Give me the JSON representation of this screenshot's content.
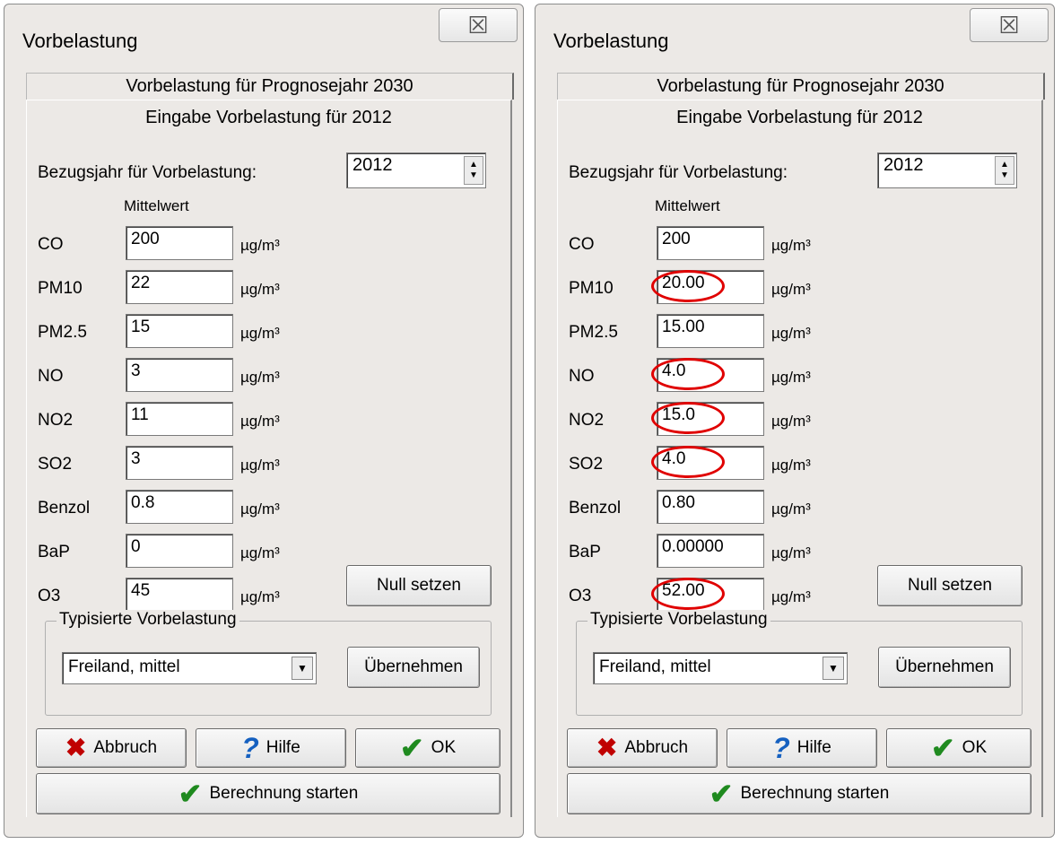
{
  "dialogs": [
    {
      "title": "Vorbelastung",
      "close_glyph": "☒",
      "tab_label": "Vorbelastung für Prognosejahr 2030",
      "panel_title": "Eingabe Vorbelastung für 2012",
      "year_label": "Bezugsjahr für Vorbelastung:",
      "year_value": "2012",
      "mean_header": "Mittelwert",
      "rows": [
        {
          "name": "CO",
          "value": "200",
          "unit": "µg/m³"
        },
        {
          "name": "PM10",
          "value": "22",
          "unit": "µg/m³"
        },
        {
          "name": "PM2.5",
          "value": "15",
          "unit": "µg/m³"
        },
        {
          "name": "NO",
          "value": "3",
          "unit": "µg/m³"
        },
        {
          "name": "NO2",
          "value": "11",
          "unit": "µg/m³"
        },
        {
          "name": "SO2",
          "value": "3",
          "unit": "µg/m³"
        },
        {
          "name": "Benzol",
          "value": "0.8",
          "unit": "µg/m³"
        },
        {
          "name": "BaP",
          "value": "0",
          "unit": "µg/m³"
        },
        {
          "name": "O3",
          "value": "45",
          "unit": "µg/m³"
        }
      ],
      "null_button": "Null setzen",
      "group_title": "Typisierte Vorbelastung",
      "combo_value": "Freiland, mittel",
      "apply_button": "Übernehmen",
      "cancel_button": "Abbruch",
      "help_button": "Hilfe",
      "ok_button": "OK",
      "start_button": "Berechnung starten"
    },
    {
      "title": "Vorbelastung",
      "close_glyph": "☒",
      "tab_label": "Vorbelastung für Prognosejahr 2030",
      "panel_title": "Eingabe Vorbelastung für 2012",
      "year_label": "Bezugsjahr für Vorbelastung:",
      "year_value": "2012",
      "mean_header": "Mittelwert",
      "rows": [
        {
          "name": "CO",
          "value": "200",
          "unit": "µg/m³",
          "highlighted": false
        },
        {
          "name": "PM10",
          "value": "20.00",
          "unit": "µg/m³",
          "highlighted": true
        },
        {
          "name": "PM2.5",
          "value": "15.00",
          "unit": "µg/m³",
          "highlighted": false
        },
        {
          "name": "NO",
          "value": "4.0",
          "unit": "µg/m³",
          "highlighted": true
        },
        {
          "name": "NO2",
          "value": "15.0",
          "unit": "µg/m³",
          "highlighted": true
        },
        {
          "name": "SO2",
          "value": "4.0",
          "unit": "µg/m³",
          "highlighted": true
        },
        {
          "name": "Benzol",
          "value": "0.80",
          "unit": "µg/m³",
          "highlighted": false
        },
        {
          "name": "BaP",
          "value": "0.00000",
          "unit": "µg/m³",
          "highlighted": false
        },
        {
          "name": "O3",
          "value": "52.00",
          "unit": "µg/m³",
          "highlighted": true
        }
      ],
      "null_button": "Null setzen",
      "group_title": "Typisierte Vorbelastung",
      "combo_value": "Freiland, mittel",
      "apply_button": "Übernehmen",
      "cancel_button": "Abbruch",
      "help_button": "Hilfe",
      "ok_button": "OK",
      "start_button": "Berechnung starten"
    }
  ],
  "highlight_color": "#e00000"
}
